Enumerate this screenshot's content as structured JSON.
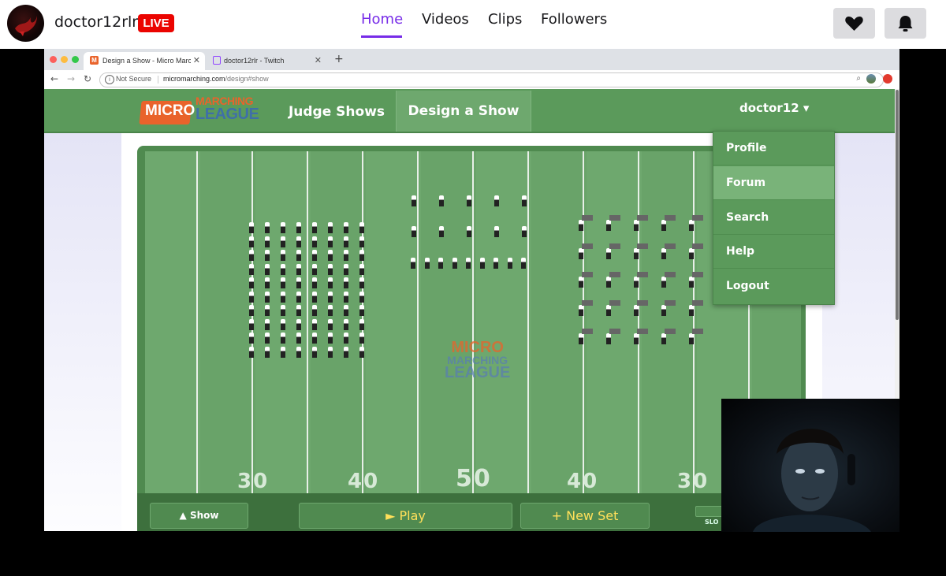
{
  "twitch": {
    "channel_name": "doctor12rlr",
    "live_badge": "LIVE",
    "nav": [
      "Home",
      "Videos",
      "Clips",
      "Followers"
    ],
    "active_nav": "Home",
    "accent": "#772ce8",
    "icons": {
      "follow": "heart-icon",
      "notifications": "bell-icon"
    }
  },
  "browser": {
    "tabs": [
      {
        "title": "Design a Show - Micro Marching",
        "favicon": "m-icon"
      },
      {
        "title": "doctor12rlr - Twitch",
        "favicon": "twitch-icon"
      }
    ],
    "new_tab": "+",
    "security_label": "Not Secure",
    "url_host": "micromarching.com",
    "url_path": "/design#show"
  },
  "site": {
    "logo_text": [
      "MICRO",
      "MARCHING",
      "LEAGUE"
    ],
    "nav": [
      "Judge Shows",
      "Design a Show"
    ],
    "active_nav": "Design a Show",
    "user_menu": "doctor12 ▾",
    "dropdown": [
      "Profile",
      "Forum",
      "Search",
      "Help",
      "Logout"
    ],
    "highlighted_item": "Forum",
    "theme_green": "#5b9a5b"
  },
  "field": {
    "yard_numbers": [
      "30",
      "40",
      "50",
      "40",
      "30"
    ],
    "watermark": [
      "MICRO",
      "MARCHING",
      "LEAGUE"
    ],
    "controls": {
      "show": "▲ Show",
      "play": "► Play",
      "new_set": "+ New Set",
      "speed_label": "SLO"
    }
  }
}
